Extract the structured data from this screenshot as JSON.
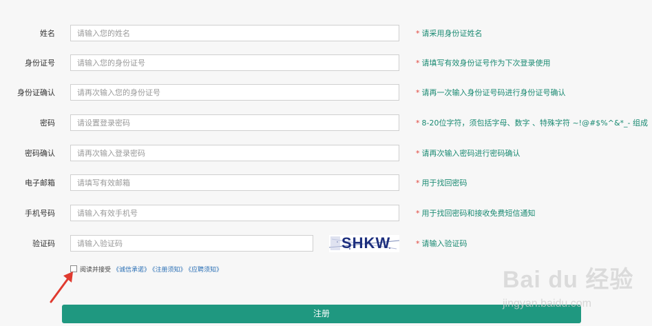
{
  "form": {
    "fields": [
      {
        "label": "姓名",
        "placeholder": "请输入您的姓名",
        "hint": "请采用身份证姓名"
      },
      {
        "label": "身份证号",
        "placeholder": "请输入您的身份证号",
        "hint": "请填写有效身份证号作为下次登录使用"
      },
      {
        "label": "身份证确认",
        "placeholder": "请再次输入您的身份证号",
        "hint": "请再一次输入身份证号码进行身份证号确认"
      },
      {
        "label": "密码",
        "placeholder": "请设置登录密码",
        "hint": "8-20位字符，须包括字母、数字 、特殊字符 ~!@#$%^&*_- 组成"
      },
      {
        "label": "密码确认",
        "placeholder": "请再次输入登录密码",
        "hint": "请再次输入密码进行密码确认"
      },
      {
        "label": "电子邮箱",
        "placeholder": "请填写有效邮箱",
        "hint": "用于找回密码"
      },
      {
        "label": "手机号码",
        "placeholder": "请输入有效手机号",
        "hint": "用于找回密码和接收免费短信通知"
      },
      {
        "label": "验证码",
        "placeholder": "请输入验证码",
        "hint": "请输入验证码"
      }
    ],
    "required_mark": "*",
    "captcha_text": "SHKW",
    "agree": {
      "text": "阅读并接受",
      "links": [
        "《诚信承诺》",
        "《注册须知》",
        "《应聘须知》"
      ],
      "checked": false
    },
    "submit_label": "注册"
  },
  "watermark": {
    "logo": "Bai du 经验",
    "site": "jingyan.baidu.com"
  },
  "colors": {
    "accent": "#1f9880",
    "hint": "#1a8a72",
    "required": "#e0443c",
    "link": "#2a6fb5",
    "arrow": "#e03a2f"
  }
}
